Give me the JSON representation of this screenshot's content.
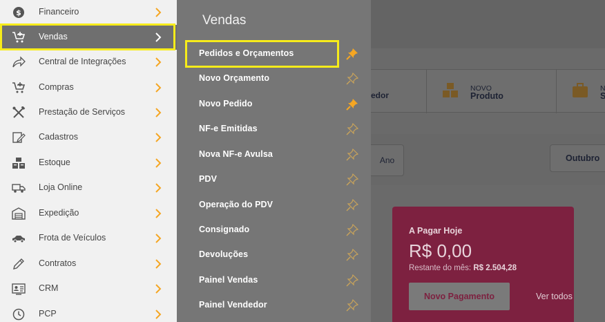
{
  "sidebar": {
    "items": [
      {
        "label": "Financeiro",
        "icon": "dollar-circle-icon"
      },
      {
        "label": "Vendas",
        "icon": "cart-add-icon"
      },
      {
        "label": "Central de Integrações",
        "icon": "share-arrow-icon"
      },
      {
        "label": "Compras",
        "icon": "cart-add-icon"
      },
      {
        "label": "Prestação de Serviços",
        "icon": "tools-icon"
      },
      {
        "label": "Cadastros",
        "icon": "edit-form-icon"
      },
      {
        "label": "Estoque",
        "icon": "boxes-icon"
      },
      {
        "label": "Loja Online",
        "icon": "delivery-truck-icon"
      },
      {
        "label": "Expedição",
        "icon": "warehouse-icon"
      },
      {
        "label": "Frota de Veículos",
        "icon": "car-icon"
      },
      {
        "label": "Contratos",
        "icon": "pen-icon"
      },
      {
        "label": "CRM",
        "icon": "contact-card-icon"
      },
      {
        "label": "PCP",
        "icon": "clock-history-icon"
      }
    ],
    "active_item": "Vendas"
  },
  "submenu": {
    "title": "Vendas",
    "items": [
      {
        "label": "Pedidos e Orçamentos",
        "pinned": true
      },
      {
        "label": "Novo Orçamento",
        "pinned": false
      },
      {
        "label": "Novo Pedido",
        "pinned": true
      },
      {
        "label": "NF-e Emitidas",
        "pinned": false
      },
      {
        "label": "Nova NF-e Avulsa",
        "pinned": false
      },
      {
        "label": "PDV",
        "pinned": false
      },
      {
        "label": "Operação do PDV",
        "pinned": false
      },
      {
        "label": "Consignado",
        "pinned": false
      },
      {
        "label": "Devoluções",
        "pinned": false
      },
      {
        "label": "Painel Vendas",
        "pinned": false
      },
      {
        "label": "Painel Vendedor",
        "pinned": false
      }
    ]
  },
  "main": {
    "shortcuts": {
      "partial_label": "edor",
      "produto_small": "NOVO",
      "produto_big": "Produto",
      "next_small": "NO",
      "next_big": "S"
    },
    "filters": {
      "ano_label": "Ano",
      "month_label": "Outubro"
    },
    "card": {
      "title": "A Pagar Hoje",
      "value": "R$ 0,00",
      "remaining_label": "Restante do mês:",
      "remaining_value": "R$ 2.504,28",
      "button_label": "Novo Pagamento",
      "link_label": "Ver todos"
    }
  },
  "colors": {
    "highlight": "#f7ec1a",
    "pin_active": "#f5a623",
    "accent_orange": "#f5a623",
    "card_pink": "#f0306a"
  }
}
